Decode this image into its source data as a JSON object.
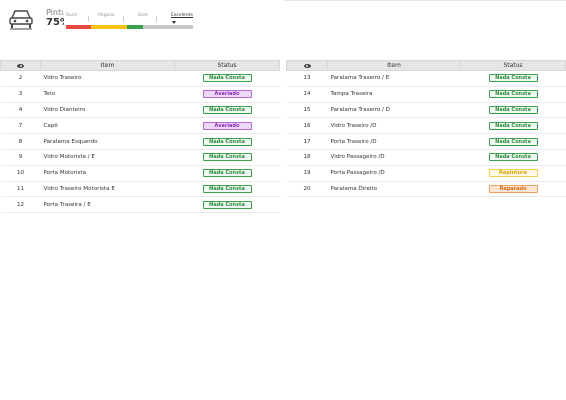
{
  "header": {
    "title": "Pintura",
    "percent": "75%",
    "scale": {
      "labels": [
        "Ruim",
        "Regular",
        "Bom",
        "Excelente"
      ],
      "active": "Excelente",
      "segment_colors": [
        "#e8493f",
        "#f5c518",
        "#3aa14c",
        "#c9c9c9"
      ]
    }
  },
  "columns": {
    "view": "",
    "item": "Item",
    "status": "Status"
  },
  "colors": {
    "nada_consta": "#3aa14c",
    "avariado": "#b36ad8",
    "repintura": "#f0cc4f",
    "reparado": "#f0a05a"
  },
  "table_left": {
    "rows": [
      {
        "num": "2",
        "item": "Vidro Traseiro",
        "status": "Nada Consta",
        "kind": "nada"
      },
      {
        "num": "3",
        "item": "Teto",
        "status": "Avariado",
        "kind": "avariado"
      },
      {
        "num": "4",
        "item": "Vidro Dianteiro",
        "status": "Nada Consta",
        "kind": "nada"
      },
      {
        "num": "7",
        "item": "Capô",
        "status": "Avariado",
        "kind": "avariado"
      },
      {
        "num": "8",
        "item": "Paralama Esquerdo",
        "status": "Nada Consta",
        "kind": "nada"
      },
      {
        "num": "9",
        "item": "Vidro Motorista / E",
        "status": "Nada Consta",
        "kind": "nada"
      },
      {
        "num": "10",
        "item": "Porta Motorista",
        "status": "Nada Consta",
        "kind": "nada"
      },
      {
        "num": "11",
        "item": "Vidro Traseiro Motorista E",
        "status": "Nada Consta",
        "kind": "nada"
      },
      {
        "num": "12",
        "item": "Porta Traseira / E",
        "status": "Nada Consta",
        "kind": "nada"
      }
    ]
  },
  "table_right": {
    "rows": [
      {
        "num": "13",
        "item": "Paralama Traseiro / E",
        "status": "Nada Consta",
        "kind": "nada"
      },
      {
        "num": "14",
        "item": "Tampa Traseira",
        "status": "Nada Consta",
        "kind": "nada"
      },
      {
        "num": "15",
        "item": "Paralama Traseiro / D",
        "status": "Nada Consta",
        "kind": "nada"
      },
      {
        "num": "16",
        "item": "Vidro Traseiro /D",
        "status": "Nada Consta",
        "kind": "nada"
      },
      {
        "num": "17",
        "item": "Porta Traseiro /D",
        "status": "Nada Consta",
        "kind": "nada"
      },
      {
        "num": "18",
        "item": "Vidro Passageiro /D",
        "status": "Nada Consta",
        "kind": "nada"
      },
      {
        "num": "19",
        "item": "Porta Passageiro /D",
        "status": "Repintura",
        "kind": "repintura"
      },
      {
        "num": "20",
        "item": "Paralama Direito",
        "status": "Reparado",
        "kind": "reparado"
      }
    ]
  },
  "icons": {
    "car": "car-front-icon",
    "view": "eye-icon"
  }
}
